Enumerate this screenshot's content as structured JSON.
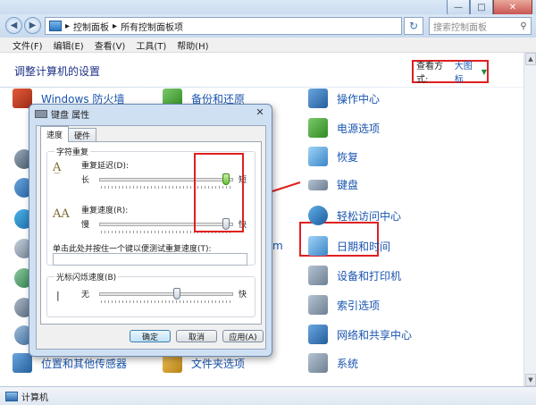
{
  "window": {
    "minimize": "—",
    "maximize": "□",
    "close": "✕"
  },
  "address": {
    "back": "◀",
    "forward": "▶",
    "path_root": "控制面板",
    "path_sep1": "▸",
    "path_leaf": "所有控制面板项",
    "path_sep2": "▸",
    "refresh": "↻",
    "search_placeholder": "搜索控制面板",
    "search_icon": "⚲"
  },
  "menu": [
    "文件(F)",
    "编辑(E)",
    "查看(V)",
    "工具(T)",
    "帮助(H)"
  ],
  "content": {
    "heading": "调整计算机的设置",
    "view_by_label": "查看方式:",
    "view_by_value": "大图标",
    "view_by_arrow": "▼"
  },
  "items": {
    "firewall": "Windows 防火墙",
    "backup": "备份和还原",
    "action_center": "操作中心",
    "power": "电源选项",
    "recovery": "恢复",
    "keyboard": "键盘",
    "ease_access": "轻松访问中心",
    "datetime": "日期和时间",
    "devices": "设备和打印机",
    "indexing": "索引选项",
    "network": "网络和共享中心",
    "location": "位置和其他传感器",
    "folder": "文件夹选项",
    "system": "系统",
    "partial_m": "m"
  },
  "status": {
    "computer": "计算机"
  },
  "dialog": {
    "title": "键盘 属性",
    "close": "✕",
    "tabs": [
      "速度",
      "硬件"
    ],
    "repeat_group": "字符重复",
    "delay_label": "重复延迟(D):",
    "delay_long": "长",
    "delay_short": "短",
    "delay_value": 1.0,
    "rate_label": "重复速度(R):",
    "rate_slow": "慢",
    "rate_fast": "快",
    "rate_value": 1.0,
    "test_label": "单击此处并按住一个键以便测试重复速度(T):",
    "cursor_group": "光标闪烁速度(B)",
    "cursor_none": "无",
    "cursor_fast": "快",
    "cursor_value": 0.6,
    "btn_ok": "确定",
    "btn_cancel": "取消",
    "btn_apply": "应用(A)"
  }
}
